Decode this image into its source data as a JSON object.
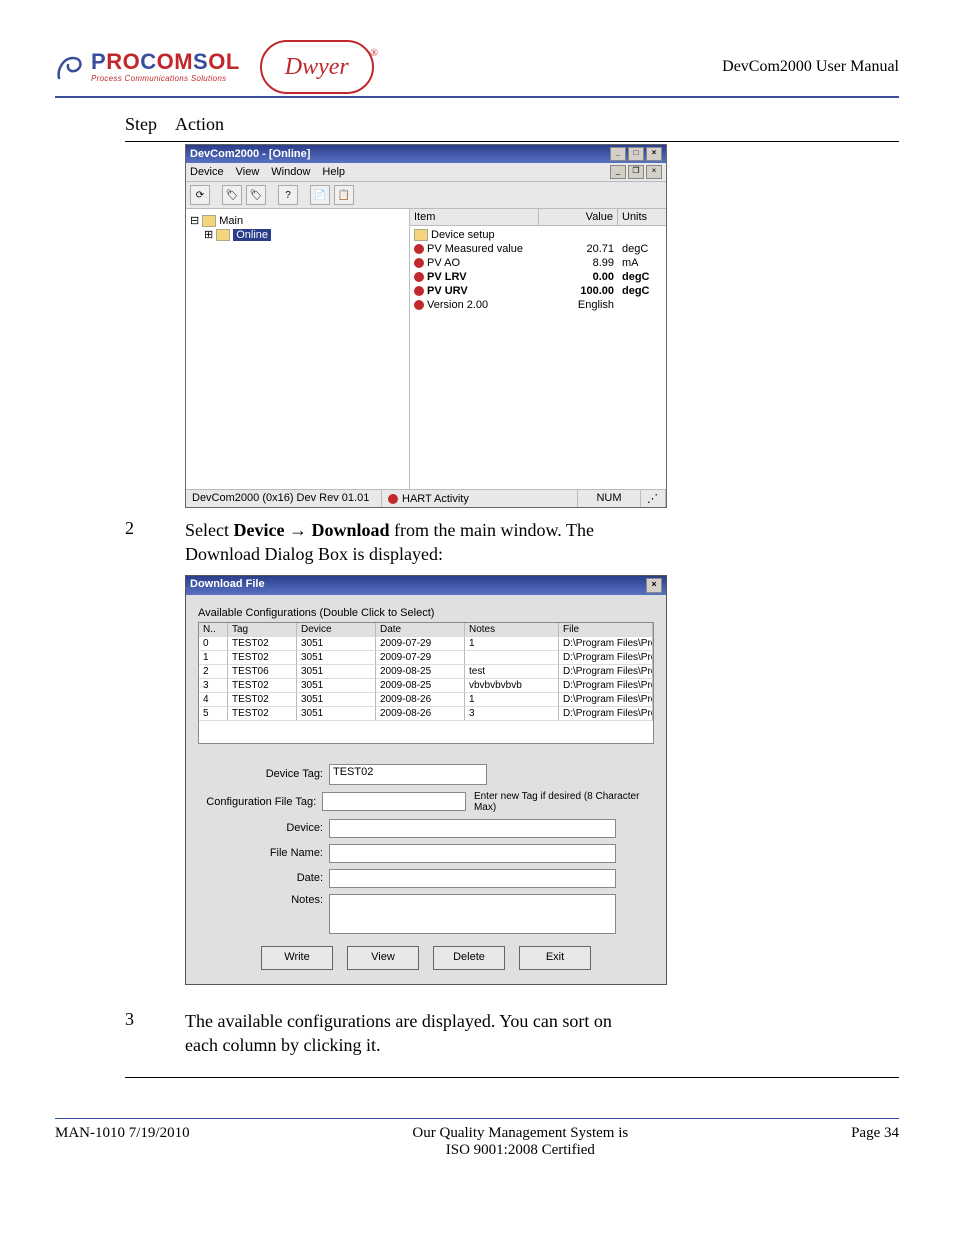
{
  "header": {
    "brand_p1": "P",
    "brand_p2": "RO",
    "brand_p3": "C",
    "brand_p4": "OM",
    "brand_p5": "S",
    "brand_p6": "OL",
    "brand_tag": "Process Communications Solutions",
    "dwyer": "Dwyer",
    "manual_title": "DevCom2000 User Manual"
  },
  "columns": {
    "step": "Step",
    "action": "Action"
  },
  "app": {
    "title": "DevCom2000 - [Online]",
    "menus": {
      "device": "Device",
      "view": "View",
      "window": "Window",
      "help": "Help"
    },
    "tree": {
      "main": "Main",
      "online": "Online"
    },
    "list": {
      "head_item": "Item",
      "head_value": "Value",
      "head_units": "Units",
      "rows": [
        {
          "item": "Device setup",
          "value": "",
          "units": ""
        },
        {
          "item": "PV Measured value",
          "value": "20.71",
          "units": "degC"
        },
        {
          "item": "PV AO",
          "value": "8.99",
          "units": "mA"
        },
        {
          "item": "PV LRV",
          "value": "0.00",
          "units": "degC",
          "bold": true
        },
        {
          "item": "PV URV",
          "value": "100.00",
          "units": "degC",
          "bold": true
        },
        {
          "item": "Version 2.00",
          "value": "English",
          "units": ""
        }
      ]
    },
    "status": {
      "left": "DevCom2000  (0x16) Dev Rev 01.01",
      "hart": "HART Activity",
      "num": "NUM"
    }
  },
  "step2": {
    "num": "2",
    "text_a": "Select ",
    "text_b": "Device ",
    "arrow": "→",
    "text_c": " Download",
    "text_d": " from the main window.  The Download Dialog Box is displayed:"
  },
  "dialog": {
    "title": "Download File",
    "caption": "Available Configurations (Double Click to Select)",
    "cols": {
      "n": "N..",
      "tag": "Tag",
      "device": "Device",
      "date": "Date",
      "notes": "Notes",
      "file": "File"
    },
    "rows": [
      {
        "n": "0",
        "tag": "TEST02",
        "device": "3051",
        "date": "2009-07-29",
        "notes": "1",
        "file": "D:\\Program Files\\ProComSol\\De..."
      },
      {
        "n": "1",
        "tag": "TEST02",
        "device": "3051",
        "date": "2009-07-29",
        "notes": "",
        "file": "D:\\Program Files\\ProComSol\\De..."
      },
      {
        "n": "2",
        "tag": "TEST06",
        "device": "3051",
        "date": "2009-08-25",
        "notes": "test",
        "file": "D:\\Program Files\\ProComSol\\De..."
      },
      {
        "n": "3",
        "tag": "TEST02",
        "device": "3051",
        "date": "2009-08-25",
        "notes": "vbvbvbvbvb",
        "file": "D:\\Program Files\\ProComSol\\De..."
      },
      {
        "n": "4",
        "tag": "TEST02",
        "device": "3051",
        "date": "2009-08-26",
        "notes": "1",
        "file": "D:\\Program Files\\ProComSol\\De..."
      },
      {
        "n": "5",
        "tag": "TEST02",
        "device": "3051",
        "date": "2009-08-26",
        "notes": "3",
        "file": "D:\\Program Files\\ProComSol\\De..."
      }
    ],
    "form": {
      "device_tag_label": "Device Tag:",
      "device_tag_value": "TEST02",
      "config_tag_label": "Configuration File Tag:",
      "config_tag_hint": "Enter new Tag if desired (8 Character Max)",
      "device_label": "Device:",
      "filename_label": "File Name:",
      "date_label": "Date:",
      "notes_label": "Notes:"
    },
    "buttons": {
      "write": "Write",
      "view": "View",
      "delete": "Delete",
      "exit": "Exit"
    }
  },
  "step3": {
    "num": "3",
    "text": "The available configurations are displayed.  You can sort on each column by clicking it."
  },
  "footer": {
    "left": "MAN-1010 7/19/2010",
    "mid1": "Our Quality Management System is",
    "mid2": "ISO 9001:2008 Certified",
    "right": "Page 34"
  }
}
